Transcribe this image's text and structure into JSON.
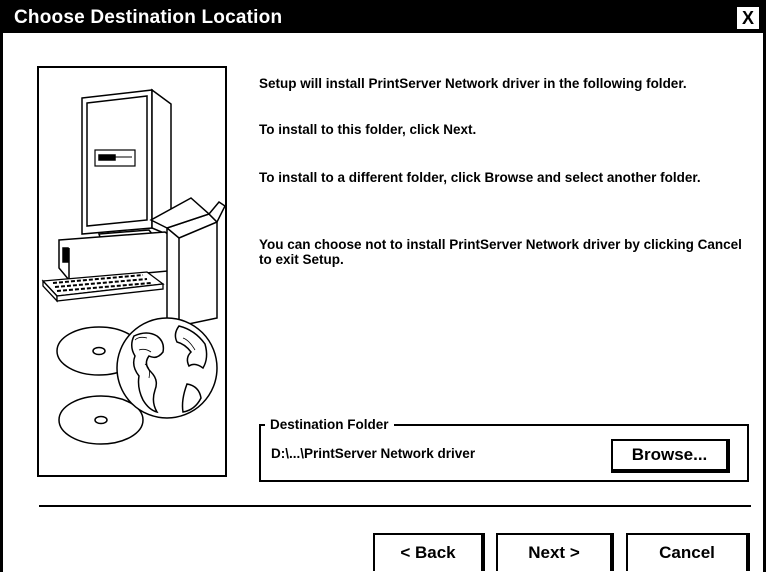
{
  "window": {
    "title": "Choose Destination Location",
    "close_label": "X"
  },
  "messages": [
    "Setup will install PrintServer Network driver in the following folder.",
    "To install to this folder, click Next.",
    "To install to a different folder, click Browse and select another folder.",
    "You can choose not to install PrintServer Network driver by clicking Cancel to exit Setup."
  ],
  "destination": {
    "group_label": "Destination Folder",
    "path": "D:\\...\\PrintServer Network driver",
    "browse_label": "Browse..."
  },
  "buttons": {
    "back": "< Back",
    "next": "Next >",
    "cancel": "Cancel"
  },
  "illustration": {
    "icons": [
      "computer-monitor-icon",
      "keyboard-icon",
      "software-box-icon",
      "cd-discs-icon",
      "globe-icon"
    ]
  }
}
